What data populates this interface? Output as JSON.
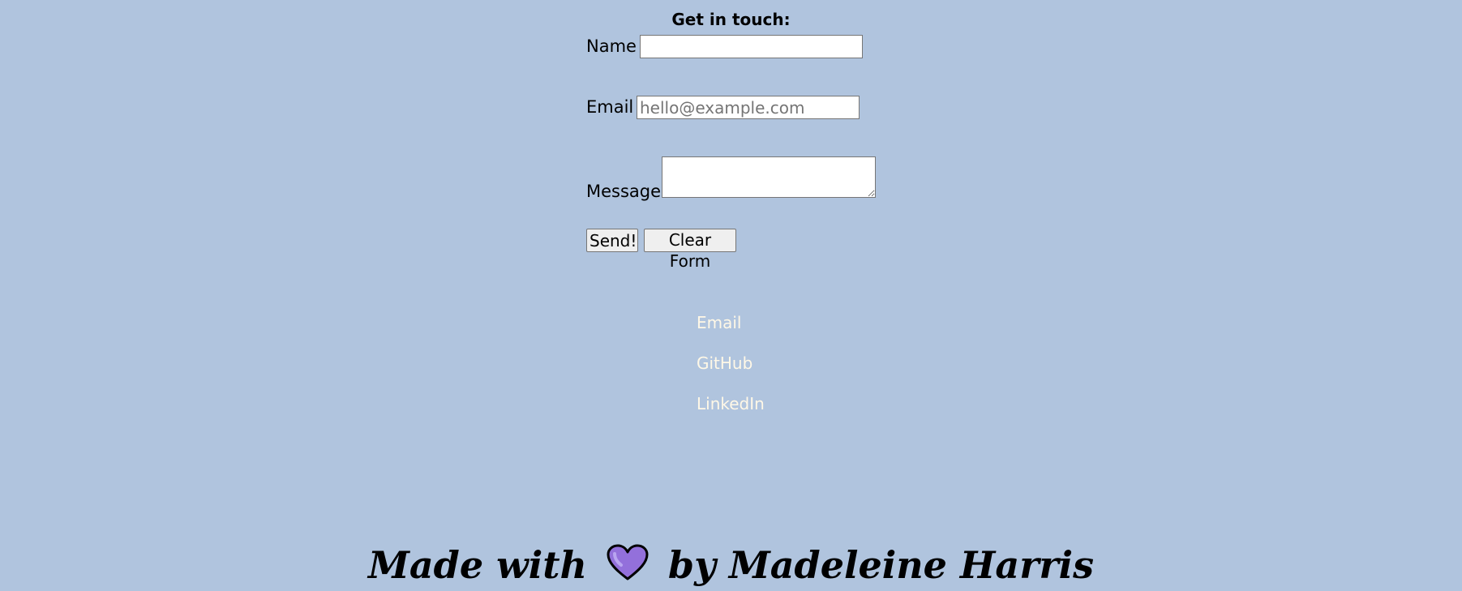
{
  "contact": {
    "title": "Get in touch:",
    "name_label": "Name",
    "name_value": "",
    "email_label": "Email",
    "email_placeholder": "hello@example.com",
    "message_label": "Message",
    "message_value": "",
    "send_label": "Send!",
    "clear_label": "Clear Form"
  },
  "links": {
    "email": "Email",
    "github": "GitHub",
    "linkedin": "LinkedIn"
  },
  "footer": {
    "prefix": "Made with",
    "heart_icon": "heart-icon",
    "heart_color": "#9370db",
    "suffix": "by Madeleine Harris"
  },
  "colors": {
    "background": "#b0c4de",
    "link": "#fff8e7"
  }
}
